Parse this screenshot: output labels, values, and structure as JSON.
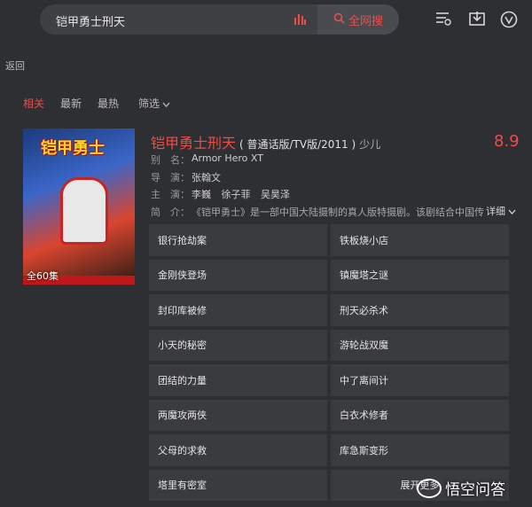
{
  "search": {
    "query": "铠甲勇士刑天",
    "button_label": "全网搜"
  },
  "nav": {
    "back_label": "返回"
  },
  "filters": {
    "tabs": [
      "相关",
      "最新",
      "最热"
    ],
    "dropdown_label": "筛选"
  },
  "result": {
    "title": "铠甲勇士刑天",
    "paren_info": "( 普通话版/TV版/2011 )",
    "category_tag": "少儿",
    "rating": "8.9",
    "poster_title": "铠甲勇士",
    "poster_episodes": "全60集",
    "meta": {
      "alias_key": "别　名：",
      "alias_value": "Armor Hero XT",
      "director_key": "导　演：",
      "director_value": "张翰文",
      "cast_key": "主　演：",
      "cast_values": [
        "李巍",
        "徐子菲",
        "吴昊泽"
      ],
      "intro_key": "简　介：",
      "intro_value": "《铠甲勇士》是一部中国大陆摄制的真人版特摄剧。该剧结合中国传"
    },
    "detail_label": "详细"
  },
  "episodes": [
    "银行抢劫案",
    "铁板烧小店",
    "金刚侠登场",
    "镇魔塔之谜",
    "封印库被修",
    "刑天必杀术",
    "小天的秘密",
    "游轮战双魔",
    "团结的力量",
    "中了离间计",
    "两魔攻两侠",
    "白衣术修者",
    "父母的求救",
    "库急斯变形",
    "塔里有密室"
  ],
  "expand_more_label": "展开更多",
  "watermark": "悟空问答",
  "colors": {
    "accent": "#f04b47",
    "background": "#2e2f33",
    "tile": "#3a3b3f"
  }
}
